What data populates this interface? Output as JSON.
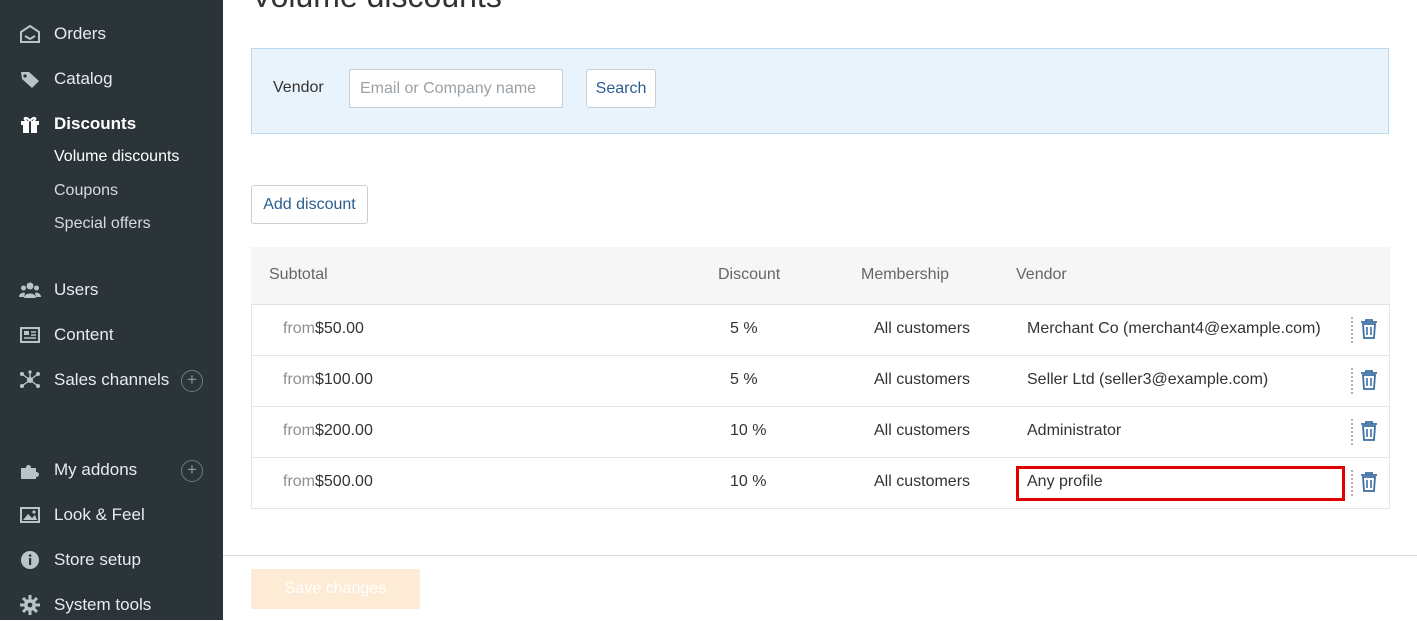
{
  "sidebar": {
    "items": [
      {
        "label": "Orders",
        "icon": "orders-icon"
      },
      {
        "label": "Catalog",
        "icon": "tag-icon"
      },
      {
        "label": "Discounts",
        "icon": "gift-icon"
      },
      {
        "label": "Users",
        "icon": "users-icon"
      },
      {
        "label": "Content",
        "icon": "content-icon"
      },
      {
        "label": "Sales channels",
        "icon": "network-icon"
      },
      {
        "label": "My addons",
        "icon": "puzzle-icon"
      },
      {
        "label": "Look & Feel",
        "icon": "image-icon"
      },
      {
        "label": "Store setup",
        "icon": "info-icon"
      },
      {
        "label": "System tools",
        "icon": "gear-icon"
      }
    ],
    "discounts_sub": [
      {
        "label": "Volume discounts"
      },
      {
        "label": "Coupons"
      },
      {
        "label": "Special offers"
      }
    ]
  },
  "page": {
    "title": "Volume discounts"
  },
  "search": {
    "label": "Vendor",
    "placeholder": "Email or Company name",
    "button": "Search"
  },
  "actions": {
    "add_discount": "Add discount",
    "save_changes": "Save changes"
  },
  "table": {
    "headers": {
      "subtotal": "Subtotal",
      "discount": "Discount",
      "membership": "Membership",
      "vendor": "Vendor"
    },
    "rows": [
      {
        "from": "from",
        "subtotal": "$50.00",
        "discount": "5 %",
        "membership": "All customers",
        "vendor": "Merchant Co (merchant4@example.com)"
      },
      {
        "from": "from",
        "subtotal": "$100.00",
        "discount": "5 %",
        "membership": "All customers",
        "vendor": "Seller Ltd (seller3@example.com)"
      },
      {
        "from": "from",
        "subtotal": "$200.00",
        "discount": "10 %",
        "membership": "All customers",
        "vendor": "Administrator"
      },
      {
        "from": "from",
        "subtotal": "$500.00",
        "discount": "10 %",
        "membership": "All customers",
        "vendor": "Any profile"
      }
    ]
  },
  "colors": {
    "sidebar_bg": "#2a3439",
    "accent": "#2a5d8f",
    "highlight": "#e00000"
  }
}
